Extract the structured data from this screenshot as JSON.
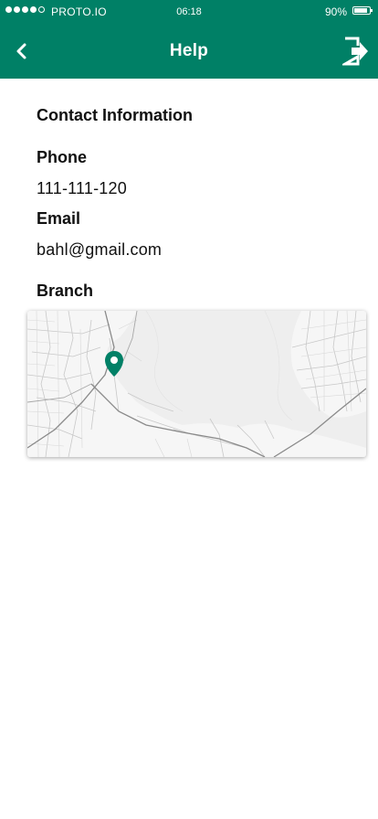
{
  "status_bar": {
    "carrier": "PROTO.IO",
    "time": "06:18",
    "battery": "90%",
    "battery_level": 0.9,
    "signal_dots_filled": 4,
    "signal_dots_total": 5
  },
  "nav": {
    "title": "Help",
    "back_icon": "chevron-left-icon",
    "logout_icon": "logout-icon",
    "background_color": "#008066"
  },
  "contact": {
    "section_title": "Contact Information",
    "phone_label": "Phone",
    "phone_value": "111-111-120",
    "email_label": "Email",
    "email_value": "bahl@gmail.com",
    "branch_label": "Branch"
  },
  "map": {
    "pin_icon": "map-pin-icon",
    "pin_color": "#008066"
  }
}
